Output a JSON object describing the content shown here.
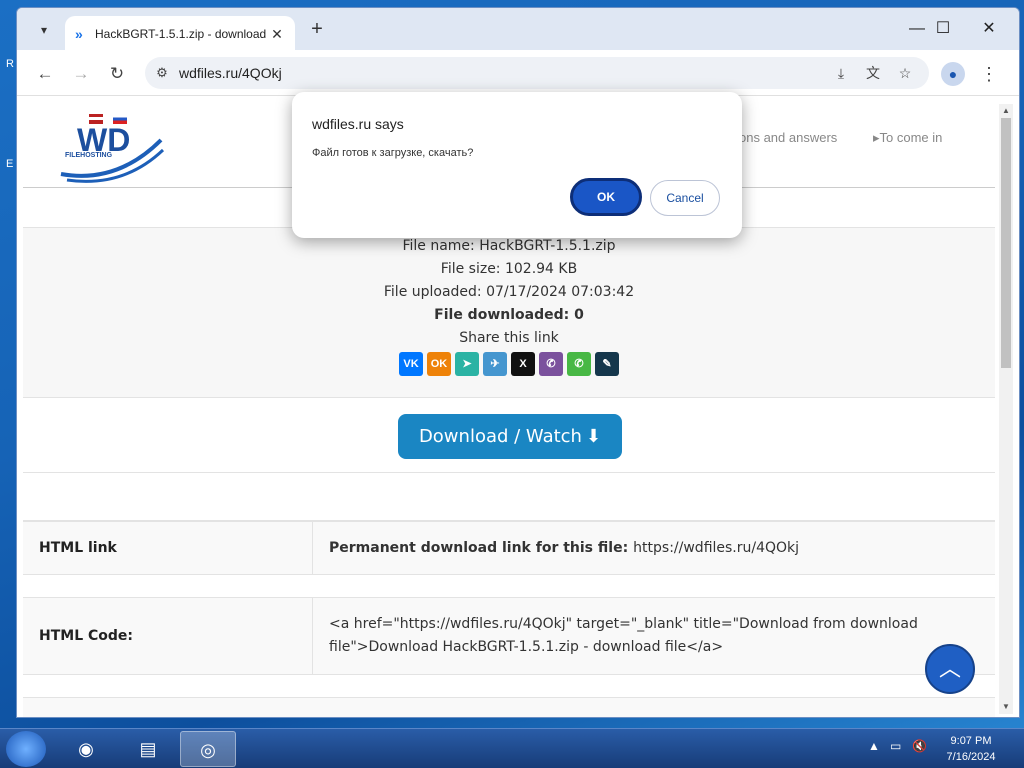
{
  "browser": {
    "tab_title": "HackBGRT-1.5.1.zip - download",
    "url": "wdfiles.ru/4QOkj"
  },
  "header": {
    "logo_text": "WD",
    "logo_subtext": "FILEHOSTING",
    "nav_partial_1": "ons and answers",
    "nav_to_come_in": "To come in"
  },
  "file_info": {
    "name": "File name: HackBGRT-1.5.1.zip",
    "size": "File size: 102.94 KB",
    "uploaded": "File uploaded: 07/17/2024 07:03:42",
    "downloaded": "File downloaded: 0",
    "share_label": "Share this link"
  },
  "share_buttons": [
    {
      "name": "vk",
      "glyph": "VK",
      "color": "#0077ff"
    },
    {
      "name": "odnoklassniki",
      "glyph": "OK",
      "color": "#ee8208"
    },
    {
      "name": "forward",
      "glyph": "➤",
      "color": "#2bb3a4"
    },
    {
      "name": "telegram",
      "glyph": "✈",
      "color": "#4596cf"
    },
    {
      "name": "x",
      "glyph": "X",
      "color": "#111111"
    },
    {
      "name": "viber",
      "glyph": "✆",
      "color": "#7b519d"
    },
    {
      "name": "whatsapp",
      "glyph": "✆",
      "color": "#48b845"
    },
    {
      "name": "livejournal",
      "glyph": "✎",
      "color": "#15374c"
    }
  ],
  "download": {
    "button_label": "Download / Watch"
  },
  "links": {
    "html_link_label": "HTML link",
    "permanent_label": "Permanent download link for this file:",
    "permanent_url": "https://wdfiles.ru/4QOkj",
    "html_code_label": "HTML Code:",
    "html_code_value": "<a href=\"https://wdfiles.ru/4QOkj\" target=\"_blank\" title=\"Download from download file\">Download HackBGRT-1.5.1.zip - download file</a>"
  },
  "dialog": {
    "title": "wdfiles.ru says",
    "message": "Файл готов к загрузке, скачать?",
    "ok_label": "OK",
    "cancel_label": "Cancel"
  },
  "taskbar": {
    "time": "9:07 PM",
    "date": "7/16/2024"
  }
}
